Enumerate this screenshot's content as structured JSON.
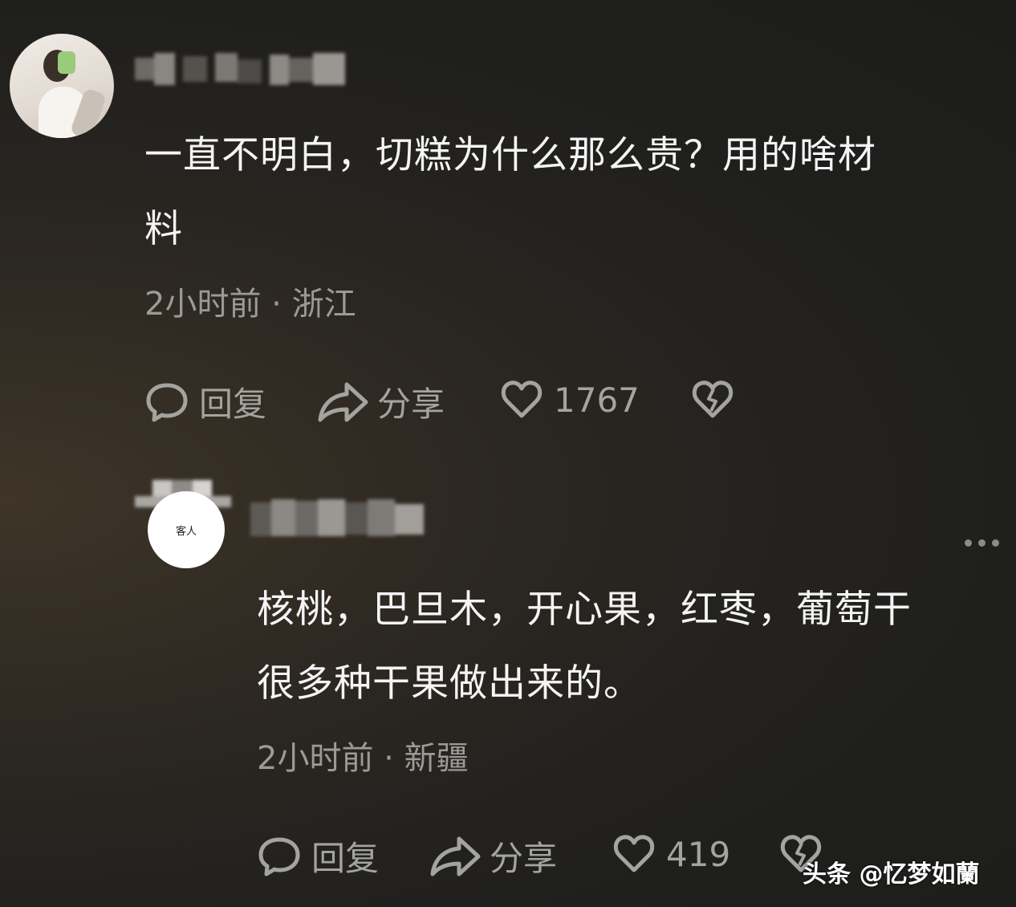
{
  "comment1": {
    "text": "一直不明白，切糕为什么那么贵？用的啥材料",
    "line1": "一直不明白，切糕为什么那么贵？用的啥材",
    "line2": "料",
    "time_location": "2小时前 · 浙江",
    "actions": {
      "reply": "回复",
      "share": "分享",
      "likes": "1767"
    }
  },
  "comment2": {
    "avatar_text": "客人",
    "line1": "核桃，巴旦木，开心果，红枣，葡萄干",
    "line2": "很多种干果做出来的。",
    "time_location": "2小时前 · 新疆",
    "actions": {
      "reply": "回复",
      "share": "分享",
      "likes": "419"
    }
  },
  "watermark": "头条 @忆梦如蘭",
  "icons": [
    "comment-bubble-icon",
    "share-arrow-icon",
    "heart-icon",
    "broken-heart-icon",
    "more-dots-icon"
  ],
  "colors": {
    "text_primary": "#f4f4f4",
    "text_secondary": "#9a9a96",
    "background": "#1f1f1d"
  }
}
